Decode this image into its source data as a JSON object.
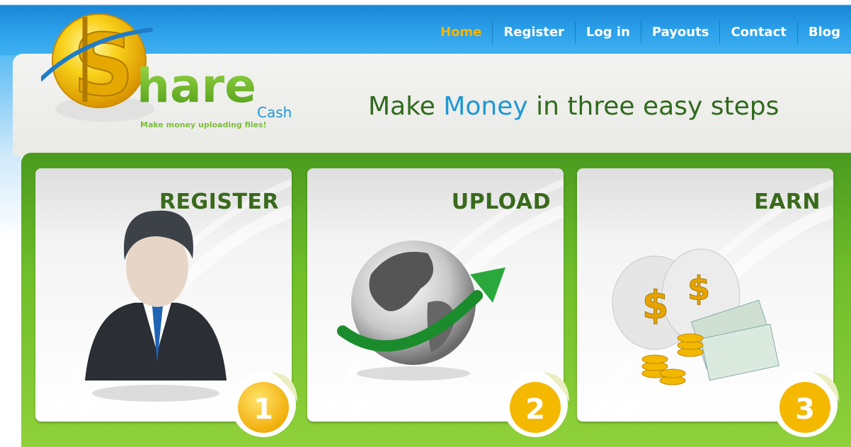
{
  "nav": {
    "items": [
      {
        "label": "Home",
        "active": true
      },
      {
        "label": "Register",
        "active": false
      },
      {
        "label": "Log in",
        "active": false
      },
      {
        "label": "Payouts",
        "active": false
      },
      {
        "label": "Contact",
        "active": false
      },
      {
        "label": "Blog",
        "active": false
      }
    ]
  },
  "logo": {
    "wordmark": "hare",
    "cash": "Cash",
    "slogan": "Make money uploading files!"
  },
  "tagline": {
    "before": "Make ",
    "highlight": "Money",
    "after": " in three easy steps"
  },
  "steps": [
    {
      "title": "REGISTER",
      "number": "1",
      "icon": "user-icon"
    },
    {
      "title": "UPLOAD",
      "number": "2",
      "icon": "globe-upload-icon"
    },
    {
      "title": "EARN",
      "number": "3",
      "icon": "money-bags-icon"
    }
  ],
  "colors": {
    "nav_bg": "#1a86d6",
    "nav_active": "#f7b500",
    "green": "#6fbd2a",
    "heading_green": "#3a6a1c",
    "accent_blue": "#1d98d5",
    "coin_gold": "#f5b800"
  }
}
